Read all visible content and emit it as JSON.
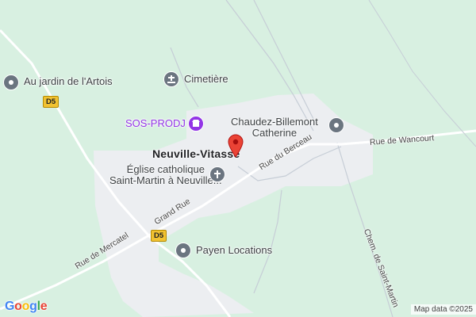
{
  "map": {
    "town_label": "Neuville-Vitasse",
    "attribution": "Map data ©2025",
    "brand": "Google",
    "colors": {
      "land": "#d8f0e1",
      "built_area": "#eceef1",
      "road": "#ffffff",
      "road_casing": "#c6cdd6",
      "route_shield": "#f1c232",
      "marker": "#ea4335",
      "poi_default": "#6b7580",
      "poi_purple": "#9334e6"
    }
  },
  "places": {
    "jardin": {
      "name": "Au jardin de l'Artois",
      "icon": "shop-icon"
    },
    "cimetiere": {
      "name": "Cimetière",
      "icon": "cemetery-icon"
    },
    "sos": {
      "name": "SOS-PRODJ",
      "icon": "store-icon"
    },
    "chaudez": {
      "line1": "Chaudez-Billemont",
      "line2": "Catherine",
      "icon": "shop-icon"
    },
    "eglise": {
      "line1": "Église catholique",
      "line2": "Saint-Martin à Neuville...",
      "icon": "church-icon"
    },
    "payen": {
      "name": "Payen Locations",
      "icon": "shop-icon"
    }
  },
  "roads": {
    "wancourt": "Rue de Wancourt",
    "berceau": "Rue du Berceau",
    "grand_rue": "Grand Rue",
    "mercatel": "Rue de Mercatel",
    "saint_martin": "Chem. de Saint-Martin",
    "d5_top": "D5",
    "d5_bottom": "D5"
  }
}
